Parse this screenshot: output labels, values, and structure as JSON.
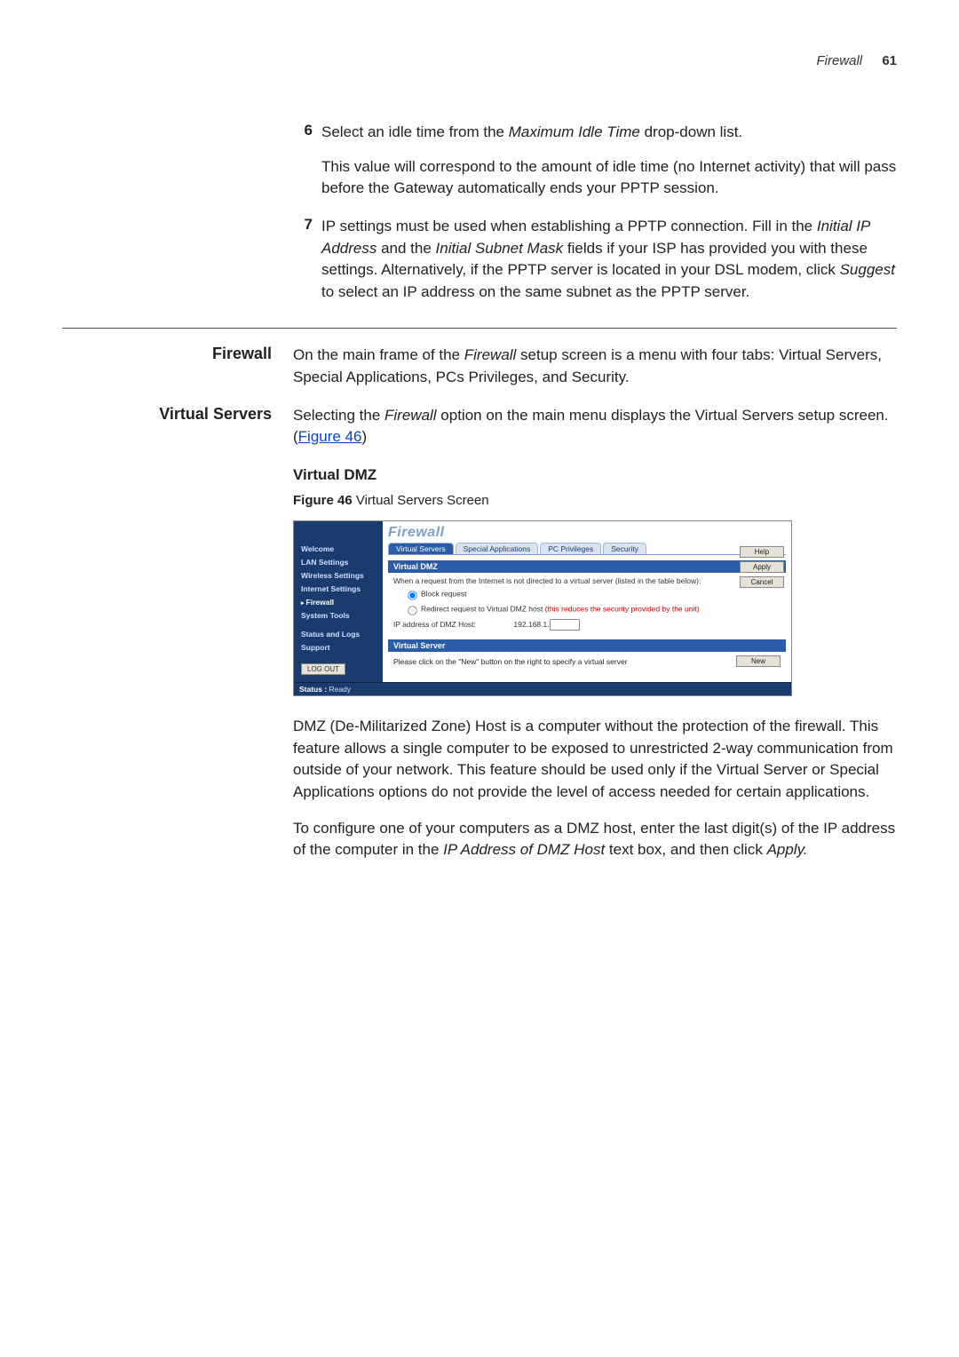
{
  "header": {
    "section": "Firewall",
    "page_number": "61"
  },
  "step6": {
    "num": "6",
    "text_a": "Select an idle time from the ",
    "ital": "Maximum Idle Time",
    "text_b": " drop-down list."
  },
  "step6_sub": "This value will correspond to the amount of idle time (no Internet activity) that will pass before the Gateway automatically ends your PPTP session.",
  "step7": {
    "num": "7",
    "text_a": "IP settings must be used when establishing a PPTP connection. Fill in the ",
    "ital1": "Initial IP Address",
    "mid1": " and the ",
    "ital2": "Initial Subnet Mask",
    "mid2": " fields if your ISP has provided you with these settings. Alternatively, if the PPTP server is located in your DSL modem, click ",
    "ital3": "Suggest",
    "tail": " to select an IP address on the same subnet as the PPTP server."
  },
  "firewall_heading": "Firewall",
  "firewall_para_a": "On the main frame of the ",
  "firewall_para_ital": "Firewall",
  "firewall_para_b": " setup screen is a menu with four tabs: Virtual Servers, Special Applications, PCs Privileges, and Security.",
  "vs_heading": "Virtual Servers",
  "vs_para_a": "Selecting the ",
  "vs_para_ital": "Firewall",
  "vs_para_b": " option on the main menu displays the Virtual Servers setup screen. (",
  "vs_para_link": "Figure 46",
  "vs_para_c": ")",
  "subheading": "Virtual DMZ",
  "fig_caption_bold": "Figure 46",
  "fig_caption_rest": "   Virtual Servers Screen",
  "screenshot": {
    "title": "Firewall",
    "sidebar": [
      "Welcome",
      "LAN Settings",
      "Wireless Settings",
      "Internet Settings",
      "Firewall",
      "System Tools",
      "Status and Logs",
      "Support"
    ],
    "logout": "LOG OUT",
    "tabs": [
      "Virtual Servers",
      "Special Applications",
      "PC Privileges",
      "Security"
    ],
    "bar1": "Virtual DMZ",
    "dmz_line": "When a request from the Internet is not directed to a virtual server (listed in the table below):",
    "radio1": "Block request",
    "radio2_a": "Redirect request to Virtual DMZ host ",
    "radio2_red": "(this reduces the security provided by the unit)",
    "ip_label": "IP address of DMZ Host:",
    "ip_prefix": "192.168.1.",
    "bar2": "Virtual Server",
    "vs_text": "Please click on the \"New\" button on the right to specify a virtual server",
    "buttons": {
      "help": "Help",
      "apply": "Apply",
      "cancel": "Cancel",
      "newbtn": "New"
    },
    "status_label": "Status :",
    "status_value": "Ready"
  },
  "dmz_para": "DMZ (De-Militarized Zone) Host is a computer without the protection of the firewall. This feature allows a single computer to be exposed to unrestricted 2-way communication from outside of your network. This feature should be used only if the Virtual Server or Special Applications options do not provide the level of access needed for certain applications.",
  "config_para_a": "To configure one of your computers as a DMZ host, enter the last digit(s) of the IP address of the computer in the ",
  "config_para_ital1": "IP Address of DMZ Host",
  "config_para_mid": " text box, and then click ",
  "config_para_ital2": "Apply.",
  "config_para_tail": ""
}
